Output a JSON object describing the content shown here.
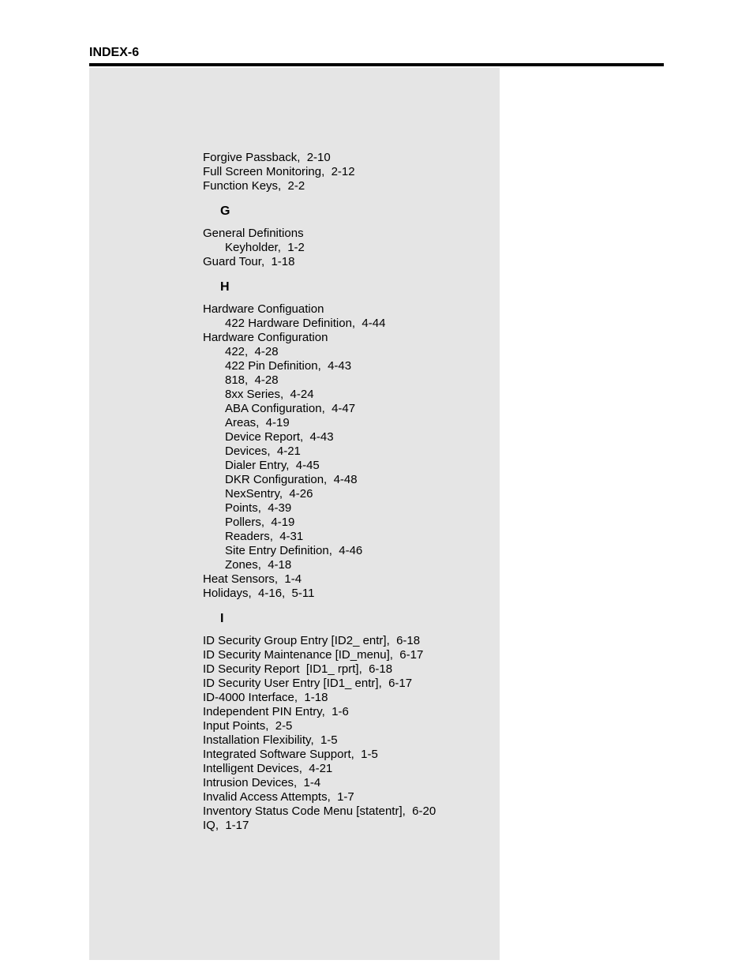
{
  "header": {
    "label": "INDEX-6"
  },
  "pre_entries": [
    {
      "text": "Forgive Passback,  2-10",
      "indent": 0
    },
    {
      "text": "Full Screen Monitoring,  2-12",
      "indent": 0
    },
    {
      "text": "Function Keys,  2-2",
      "indent": 0
    }
  ],
  "sections": [
    {
      "letter": "G",
      "entries": [
        {
          "text": "General Definitions",
          "indent": 0
        },
        {
          "text": "Keyholder,  1-2",
          "indent": 1
        },
        {
          "text": "Guard Tour,  1-18",
          "indent": 0
        }
      ]
    },
    {
      "letter": "H",
      "entries": [
        {
          "text": "Hardware Configuation",
          "indent": 0
        },
        {
          "text": "422 Hardware Definition,  4-44",
          "indent": 1
        },
        {
          "text": "Hardware Configuration",
          "indent": 0
        },
        {
          "text": "422,  4-28",
          "indent": 1
        },
        {
          "text": "422 Pin Definition,  4-43",
          "indent": 1
        },
        {
          "text": "818,  4-28",
          "indent": 1
        },
        {
          "text": "8xx Series,  4-24",
          "indent": 1
        },
        {
          "text": "ABA Configuration,  4-47",
          "indent": 1
        },
        {
          "text": "Areas,  4-19",
          "indent": 1
        },
        {
          "text": "Device Report,  4-43",
          "indent": 1
        },
        {
          "text": "Devices,  4-21",
          "indent": 1
        },
        {
          "text": "Dialer Entry,  4-45",
          "indent": 1
        },
        {
          "text": "DKR Configuration,  4-48",
          "indent": 1
        },
        {
          "text": "NexSentry,  4-26",
          "indent": 1
        },
        {
          "text": "Points,  4-39",
          "indent": 1
        },
        {
          "text": "Pollers,  4-19",
          "indent": 1
        },
        {
          "text": "Readers,  4-31",
          "indent": 1
        },
        {
          "text": "Site Entry Definition,  4-46",
          "indent": 1
        },
        {
          "text": "Zones,  4-18",
          "indent": 1
        },
        {
          "text": "Heat Sensors,  1-4",
          "indent": 0
        },
        {
          "text": "Holidays,  4-16,  5-11",
          "indent": 0
        }
      ]
    },
    {
      "letter": "I",
      "entries": [
        {
          "text": "ID Security Group Entry [ID2_ entr],  6-18",
          "indent": 0
        },
        {
          "text": "ID Security Maintenance [ID_menu],  6-17",
          "indent": 0
        },
        {
          "text": "ID Security Report  [ID1_ rprt],  6-18",
          "indent": 0
        },
        {
          "text": "ID Security User Entry [ID1_ entr],  6-17",
          "indent": 0
        },
        {
          "text": "ID-4000 Interface,  1-18",
          "indent": 0
        },
        {
          "text": "Independent PIN Entry,  1-6",
          "indent": 0
        },
        {
          "text": "Input Points,  2-5",
          "indent": 0
        },
        {
          "text": "Installation Flexibility,  1-5",
          "indent": 0
        },
        {
          "text": "Integrated Software Support,  1-5",
          "indent": 0
        },
        {
          "text": "Intelligent Devices,  4-21",
          "indent": 0
        },
        {
          "text": "Intrusion Devices,  1-4",
          "indent": 0
        },
        {
          "text": "Invalid Access Attempts,  1-7",
          "indent": 0
        },
        {
          "text": "Inventory Status Code Menu [statentr],  6-20",
          "indent": 0
        },
        {
          "text": "IQ,  1-17",
          "indent": 0
        }
      ]
    }
  ]
}
